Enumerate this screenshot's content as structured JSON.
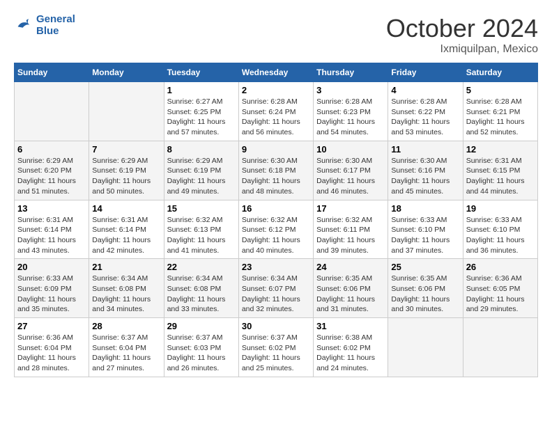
{
  "header": {
    "logo_line1": "General",
    "logo_line2": "Blue",
    "month": "October 2024",
    "location": "Ixmiquilpan, Mexico"
  },
  "weekdays": [
    "Sunday",
    "Monday",
    "Tuesday",
    "Wednesday",
    "Thursday",
    "Friday",
    "Saturday"
  ],
  "weeks": [
    [
      {
        "day": "",
        "sunrise": "",
        "sunset": "",
        "daylight": ""
      },
      {
        "day": "",
        "sunrise": "",
        "sunset": "",
        "daylight": ""
      },
      {
        "day": "1",
        "sunrise": "Sunrise: 6:27 AM",
        "sunset": "Sunset: 6:25 PM",
        "daylight": "Daylight: 11 hours and 57 minutes."
      },
      {
        "day": "2",
        "sunrise": "Sunrise: 6:28 AM",
        "sunset": "Sunset: 6:24 PM",
        "daylight": "Daylight: 11 hours and 56 minutes."
      },
      {
        "day": "3",
        "sunrise": "Sunrise: 6:28 AM",
        "sunset": "Sunset: 6:23 PM",
        "daylight": "Daylight: 11 hours and 54 minutes."
      },
      {
        "day": "4",
        "sunrise": "Sunrise: 6:28 AM",
        "sunset": "Sunset: 6:22 PM",
        "daylight": "Daylight: 11 hours and 53 minutes."
      },
      {
        "day": "5",
        "sunrise": "Sunrise: 6:28 AM",
        "sunset": "Sunset: 6:21 PM",
        "daylight": "Daylight: 11 hours and 52 minutes."
      }
    ],
    [
      {
        "day": "6",
        "sunrise": "Sunrise: 6:29 AM",
        "sunset": "Sunset: 6:20 PM",
        "daylight": "Daylight: 11 hours and 51 minutes."
      },
      {
        "day": "7",
        "sunrise": "Sunrise: 6:29 AM",
        "sunset": "Sunset: 6:19 PM",
        "daylight": "Daylight: 11 hours and 50 minutes."
      },
      {
        "day": "8",
        "sunrise": "Sunrise: 6:29 AM",
        "sunset": "Sunset: 6:19 PM",
        "daylight": "Daylight: 11 hours and 49 minutes."
      },
      {
        "day": "9",
        "sunrise": "Sunrise: 6:30 AM",
        "sunset": "Sunset: 6:18 PM",
        "daylight": "Daylight: 11 hours and 48 minutes."
      },
      {
        "day": "10",
        "sunrise": "Sunrise: 6:30 AM",
        "sunset": "Sunset: 6:17 PM",
        "daylight": "Daylight: 11 hours and 46 minutes."
      },
      {
        "day": "11",
        "sunrise": "Sunrise: 6:30 AM",
        "sunset": "Sunset: 6:16 PM",
        "daylight": "Daylight: 11 hours and 45 minutes."
      },
      {
        "day": "12",
        "sunrise": "Sunrise: 6:31 AM",
        "sunset": "Sunset: 6:15 PM",
        "daylight": "Daylight: 11 hours and 44 minutes."
      }
    ],
    [
      {
        "day": "13",
        "sunrise": "Sunrise: 6:31 AM",
        "sunset": "Sunset: 6:14 PM",
        "daylight": "Daylight: 11 hours and 43 minutes."
      },
      {
        "day": "14",
        "sunrise": "Sunrise: 6:31 AM",
        "sunset": "Sunset: 6:14 PM",
        "daylight": "Daylight: 11 hours and 42 minutes."
      },
      {
        "day": "15",
        "sunrise": "Sunrise: 6:32 AM",
        "sunset": "Sunset: 6:13 PM",
        "daylight": "Daylight: 11 hours and 41 minutes."
      },
      {
        "day": "16",
        "sunrise": "Sunrise: 6:32 AM",
        "sunset": "Sunset: 6:12 PM",
        "daylight": "Daylight: 11 hours and 40 minutes."
      },
      {
        "day": "17",
        "sunrise": "Sunrise: 6:32 AM",
        "sunset": "Sunset: 6:11 PM",
        "daylight": "Daylight: 11 hours and 39 minutes."
      },
      {
        "day": "18",
        "sunrise": "Sunrise: 6:33 AM",
        "sunset": "Sunset: 6:10 PM",
        "daylight": "Daylight: 11 hours and 37 minutes."
      },
      {
        "day": "19",
        "sunrise": "Sunrise: 6:33 AM",
        "sunset": "Sunset: 6:10 PM",
        "daylight": "Daylight: 11 hours and 36 minutes."
      }
    ],
    [
      {
        "day": "20",
        "sunrise": "Sunrise: 6:33 AM",
        "sunset": "Sunset: 6:09 PM",
        "daylight": "Daylight: 11 hours and 35 minutes."
      },
      {
        "day": "21",
        "sunrise": "Sunrise: 6:34 AM",
        "sunset": "Sunset: 6:08 PM",
        "daylight": "Daylight: 11 hours and 34 minutes."
      },
      {
        "day": "22",
        "sunrise": "Sunrise: 6:34 AM",
        "sunset": "Sunset: 6:08 PM",
        "daylight": "Daylight: 11 hours and 33 minutes."
      },
      {
        "day": "23",
        "sunrise": "Sunrise: 6:34 AM",
        "sunset": "Sunset: 6:07 PM",
        "daylight": "Daylight: 11 hours and 32 minutes."
      },
      {
        "day": "24",
        "sunrise": "Sunrise: 6:35 AM",
        "sunset": "Sunset: 6:06 PM",
        "daylight": "Daylight: 11 hours and 31 minutes."
      },
      {
        "day": "25",
        "sunrise": "Sunrise: 6:35 AM",
        "sunset": "Sunset: 6:06 PM",
        "daylight": "Daylight: 11 hours and 30 minutes."
      },
      {
        "day": "26",
        "sunrise": "Sunrise: 6:36 AM",
        "sunset": "Sunset: 6:05 PM",
        "daylight": "Daylight: 11 hours and 29 minutes."
      }
    ],
    [
      {
        "day": "27",
        "sunrise": "Sunrise: 6:36 AM",
        "sunset": "Sunset: 6:04 PM",
        "daylight": "Daylight: 11 hours and 28 minutes."
      },
      {
        "day": "28",
        "sunrise": "Sunrise: 6:37 AM",
        "sunset": "Sunset: 6:04 PM",
        "daylight": "Daylight: 11 hours and 27 minutes."
      },
      {
        "day": "29",
        "sunrise": "Sunrise: 6:37 AM",
        "sunset": "Sunset: 6:03 PM",
        "daylight": "Daylight: 11 hours and 26 minutes."
      },
      {
        "day": "30",
        "sunrise": "Sunrise: 6:37 AM",
        "sunset": "Sunset: 6:02 PM",
        "daylight": "Daylight: 11 hours and 25 minutes."
      },
      {
        "day": "31",
        "sunrise": "Sunrise: 6:38 AM",
        "sunset": "Sunset: 6:02 PM",
        "daylight": "Daylight: 11 hours and 24 minutes."
      },
      {
        "day": "",
        "sunrise": "",
        "sunset": "",
        "daylight": ""
      },
      {
        "day": "",
        "sunrise": "",
        "sunset": "",
        "daylight": ""
      }
    ]
  ]
}
